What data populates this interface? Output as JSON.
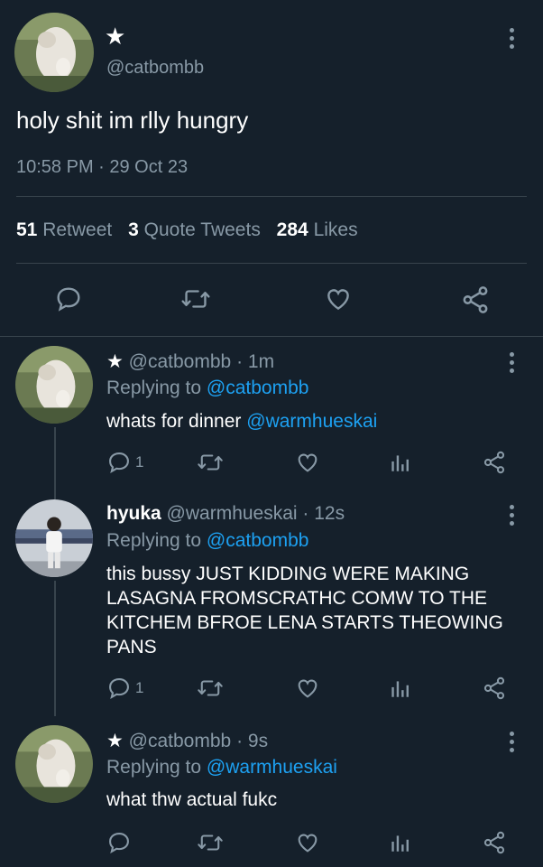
{
  "main": {
    "name": "★",
    "handle": "@catbombb",
    "text": "holy shit im rlly hungry",
    "meta": "10:58 PM · 29 Oct 23",
    "stats": {
      "retweets_count": "51",
      "retweets_label": "Retweet",
      "quotes_count": "3",
      "quotes_label": "Quote Tweets",
      "likes_count": "284",
      "likes_label": "Likes"
    }
  },
  "replies": [
    {
      "star": "★",
      "handle": "@catbombb",
      "time": "· 1m",
      "replying_prefix": "Replying to",
      "replying_to": "@catbombb",
      "text": "whats for dinner",
      "mention": "@warmhueskai",
      "reply_count": "1"
    },
    {
      "name": "hyuka",
      "handle": "@warmhueskai",
      "time": "· 12s",
      "replying_prefix": "Replying to",
      "replying_to": "@catbombb",
      "text": "this bussy JUST KIDDING WERE MAKING LASAGNA FROMSCRATHC COMW TO THE KITCHEM BFROE LENA STARTS THEOWING PANS",
      "reply_count": "1"
    },
    {
      "star": "★",
      "handle": "@catbombb",
      "time": "· 9s",
      "replying_prefix": "Replying to",
      "replying_to": "@warmhueskai",
      "text": "what thw actual fukc"
    }
  ],
  "icons": [
    "more-icon",
    "reply-icon",
    "retweet-icon",
    "like-icon",
    "share-icon",
    "analytics-icon"
  ],
  "colors": {
    "background": "#15202b",
    "muted": "#8899a6",
    "link": "#1da1f2",
    "divider": "#38444d"
  }
}
